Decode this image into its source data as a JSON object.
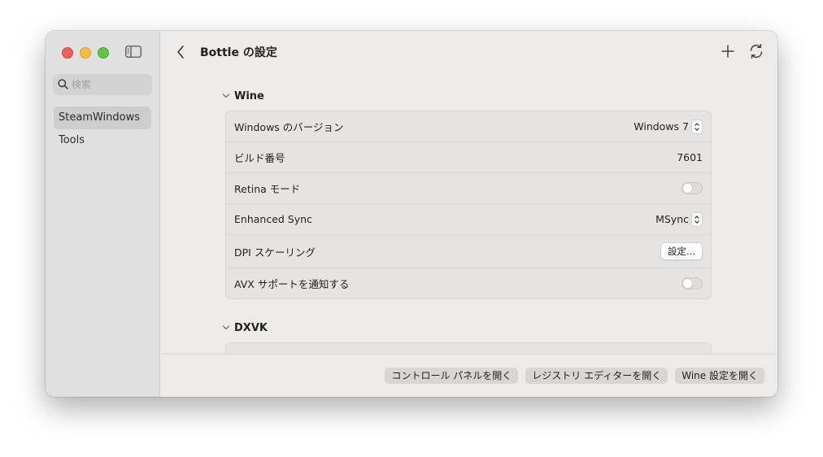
{
  "sidebar": {
    "search_placeholder": "検索",
    "items": [
      {
        "label": "SteamWindows",
        "active": true
      },
      {
        "label": "Tools",
        "active": false
      }
    ]
  },
  "toolbar": {
    "title": "Bottle の設定"
  },
  "sections": {
    "wine": {
      "title": "Wine",
      "rows": {
        "windows_version": {
          "label": "Windows のバージョン",
          "value": "Windows 7"
        },
        "build_number": {
          "label": "ビルド番号",
          "value": "7601"
        },
        "retina_mode": {
          "label": "Retina モード",
          "enabled": false
        },
        "enhanced_sync": {
          "label": "Enhanced Sync",
          "value": "MSync"
        },
        "dpi_scaling": {
          "label": "DPI スケーリング",
          "button": "設定..."
        },
        "avx_support": {
          "label": "AVX サポートを通知する",
          "enabled": false
        }
      }
    },
    "dxvk": {
      "title": "DXVK"
    }
  },
  "footer": {
    "control_panel": "コントロール パネルを開く",
    "registry_editor": "レジストリ エディターを開く",
    "wine_config": "Wine 設定を開く"
  },
  "colors": {
    "close": "#ee5f57",
    "minimize": "#f4bd3f",
    "maximize": "#5fc43f"
  }
}
